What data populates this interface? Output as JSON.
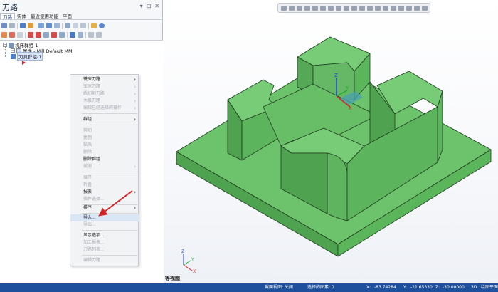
{
  "panel": {
    "title": "刀路",
    "controls": [
      "▾",
      "⊡",
      "✕"
    ],
    "tabs": [
      "刀路",
      "实体",
      "最近使用功能",
      "平面"
    ]
  },
  "tree": {
    "machine_group": "机床群组-1",
    "properties": "属性 - Mill Default MM",
    "toolpath_group": "刀具群组-1",
    "expand_symbol": "−"
  },
  "context_menu": {
    "items": [
      {
        "label": "铣床刀路",
        "enabled": true,
        "submenu": true
      },
      {
        "label": "车床刀路",
        "enabled": false,
        "submenu": true
      },
      {
        "label": "线切割刀路",
        "enabled": false,
        "submenu": true
      },
      {
        "label": "木雕刀路",
        "enabled": false,
        "submenu": true
      },
      {
        "label": "编辑已经选择的操作",
        "enabled": false,
        "submenu": true
      },
      {
        "label": "群组",
        "enabled": true,
        "submenu": true
      },
      {
        "label": "剪切",
        "enabled": false,
        "submenu": false
      },
      {
        "label": "复制",
        "enabled": false,
        "submenu": false
      },
      {
        "label": "粘贴",
        "enabled": false,
        "submenu": false
      },
      {
        "label": "删除",
        "enabled": false,
        "submenu": false
      },
      {
        "label": "删除群组",
        "enabled": true,
        "submenu": false
      },
      {
        "label": "撤消",
        "enabled": false,
        "submenu": true
      },
      {
        "label": "展开",
        "enabled": false,
        "submenu": false
      },
      {
        "label": "折叠",
        "enabled": false,
        "submenu": false
      },
      {
        "label": "报表",
        "enabled": true,
        "submenu": true
      },
      {
        "label": "插件选择...",
        "enabled": false,
        "submenu": false
      },
      {
        "label": "排序",
        "enabled": true,
        "submenu": true
      },
      {
        "label": "导入...",
        "enabled": true,
        "submenu": false,
        "highlighted": true
      },
      {
        "label": "导出...",
        "enabled": false,
        "submenu": false
      },
      {
        "label": "显示选项...",
        "enabled": true,
        "submenu": false
      },
      {
        "label": "加工报表...",
        "enabled": false,
        "submenu": false
      },
      {
        "label": "刀路列表...",
        "enabled": false,
        "submenu": false
      },
      {
        "label": "编辑刀路",
        "enabled": false,
        "submenu": false
      }
    ],
    "submenu_arrow": "›"
  },
  "viewport": {
    "view_label": "等视图",
    "axis_labels": {
      "x": "X",
      "y": "Y",
      "z": "Z"
    },
    "colors": {
      "part_top": "#6cc36c",
      "part_front": "#4fa24f",
      "part_side": "#5bb55b",
      "edge": "#1f3a1f"
    }
  },
  "statusbar": {
    "section_view": "截面视图: 关闭",
    "selected": "选择的图素: 0",
    "x_label": "X:",
    "x_value": "-83.74284",
    "y_label": "Y:",
    "y_value": "-21.65330",
    "z_label": "Z:",
    "z_value": "-30.00000",
    "mode": "3D",
    "plane": "绘图平面"
  }
}
